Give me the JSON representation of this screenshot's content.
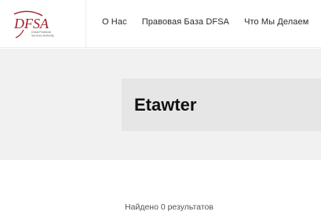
{
  "header": {
    "logo": {
      "text": "DFSA",
      "subtitle_line1": "Dubai Financial",
      "subtitle_line2": "Services Authority",
      "color": "#a11d2b"
    },
    "nav": [
      {
        "label": "О Нас"
      },
      {
        "label": "Правовая База DFSA"
      },
      {
        "label": "Что Мы Делаем"
      }
    ]
  },
  "hero": {
    "title": "Etawter"
  },
  "search": {
    "results_text": "Найдено 0 результатов"
  }
}
